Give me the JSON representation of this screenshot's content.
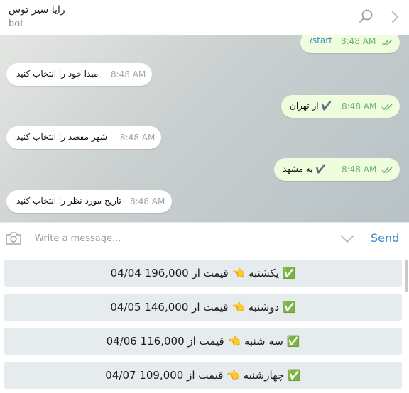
{
  "header": {
    "title": "رایا سیر توس",
    "subtitle": "bot"
  },
  "messages": [
    {
      "text": "/start",
      "time": "8:48 AM"
    },
    {
      "text": "مبدا خود را انتخاب کنید",
      "time": "8:48 AM"
    },
    {
      "text": "✔️ از تهران",
      "time": "8:48 AM"
    },
    {
      "text": "شهر مقصد را انتخاب کنید",
      "time": "8:48 AM"
    },
    {
      "text": "✔️ به مشهد",
      "time": "8:48 AM"
    },
    {
      "text": "تاریخ مورد نظر را انتخاب کنید",
      "time": "8:48 AM"
    }
  ],
  "input": {
    "placeholder": "Write a message...",
    "send_label": "Send"
  },
  "keyboard": [
    {
      "label": "04/04  یکشنبه 👈 قیمت از 196,000 ✅"
    },
    {
      "label": "04/05  دوشنبه 👈 قیمت از 146,000 ✅"
    },
    {
      "label": "04/06  سه شنبه 👈 قیمت از 116,000 ✅"
    },
    {
      "label": "04/07  چهارشنبه 👈 قیمت از 109,000 ✅"
    }
  ],
  "colors": {
    "accent": "#3a88c8",
    "outgoing_bubble": "#effdde",
    "incoming_bubble": "#ffffff",
    "keyboard_button": "#e6ebee",
    "read_ticks": "#6cb36d"
  }
}
